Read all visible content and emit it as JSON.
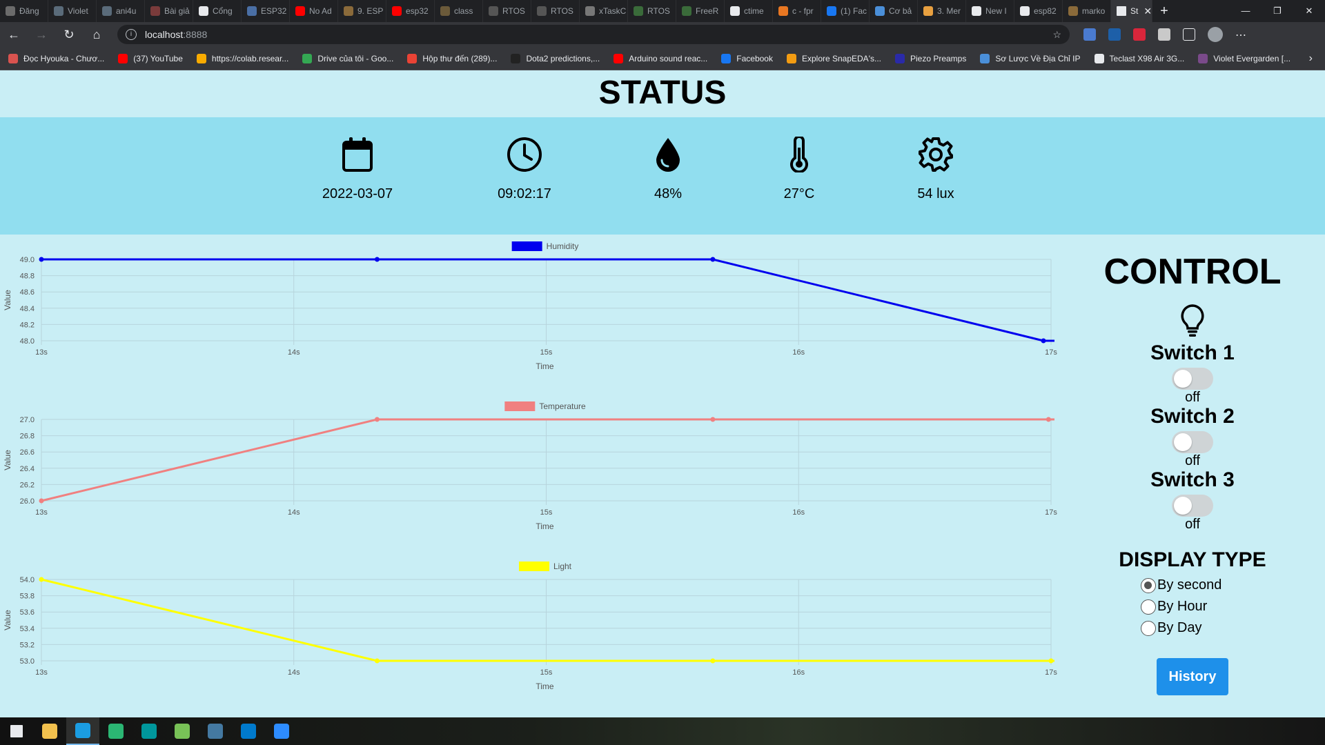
{
  "browser": {
    "tabs": [
      {
        "label": "Đăng",
        "color": "#6b6b6b"
      },
      {
        "label": "Violet",
        "color": "#5a6b7a"
      },
      {
        "label": "ani4u",
        "color": "#5a6b7a"
      },
      {
        "label": "Bài giả",
        "color": "#7a3b3b"
      },
      {
        "label": "Cổng",
        "color": "#e8eaed"
      },
      {
        "label": "ESP32",
        "color": "#4a6fa5"
      },
      {
        "label": "No Ad",
        "color": "#ff0000"
      },
      {
        "label": "9. ESP",
        "color": "#8a6a3a"
      },
      {
        "label": "esp32",
        "color": "#ff0000"
      },
      {
        "label": "class",
        "color": "#6b5a3a"
      },
      {
        "label": "RTOS",
        "color": "#555"
      },
      {
        "label": "RTOS",
        "color": "#555"
      },
      {
        "label": "xTaskC",
        "color": "#777"
      },
      {
        "label": "RTOS",
        "color": "#3a6b3a"
      },
      {
        "label": "FreeR",
        "color": "#3a6b3a"
      },
      {
        "label": "ctime",
        "color": "#e8eaed"
      },
      {
        "label": "c - fpr",
        "color": "#e87722"
      },
      {
        "label": "(1) Fac",
        "color": "#1877f2"
      },
      {
        "label": "Cơ bả",
        "color": "#4a8fd9"
      },
      {
        "label": "3. Mer",
        "color": "#e8a040"
      },
      {
        "label": "New I",
        "color": "#e8eaed"
      },
      {
        "label": "esp82",
        "color": "#e8eaed"
      },
      {
        "label": "marko",
        "color": "#8a6a3a"
      }
    ],
    "active_tab": {
      "label": "St",
      "close": "✕"
    },
    "new_tab": "+",
    "window_controls": {
      "minimize": "—",
      "restore": "❐",
      "close": "✕"
    },
    "url_host": "localhost",
    "url_port": ":8888",
    "bookmarks": [
      {
        "label": "Đọc Hyouka - Chươ...",
        "color": "#d9534f"
      },
      {
        "label": "(37) YouTube",
        "color": "#ff0000"
      },
      {
        "label": "https://colab.resear...",
        "color": "#f9ab00"
      },
      {
        "label": "Drive của tôi - Goo...",
        "color": "#34a853"
      },
      {
        "label": "Hộp thư đến (289)...",
        "color": "#ea4335"
      },
      {
        "label": "Dota2 predictions,...",
        "color": "#222"
      },
      {
        "label": "Arduino sound reac...",
        "color": "#ff0000"
      },
      {
        "label": "Facebook",
        "color": "#1877f2"
      },
      {
        "label": "Explore SnapEDA's...",
        "color": "#f39c12"
      },
      {
        "label": "Piezo Preamps",
        "color": "#2a2aa8"
      },
      {
        "label": "Sơ Lược Về Địa Chỉ IP",
        "color": "#4a8fd9"
      },
      {
        "label": "Teclast X98 Air 3G...",
        "color": "#e8eaed"
      },
      {
        "label": "Violet Evergarden [...",
        "color": "#7a4a8a"
      }
    ]
  },
  "status": {
    "title": "STATUS",
    "date": "2022-03-07",
    "time": "09:02:17",
    "humidity": "48%",
    "temperature": "27°C",
    "light": "54 lux"
  },
  "control": {
    "title": "CONTROL",
    "switches": [
      {
        "label": "Switch 1",
        "state": "off"
      },
      {
        "label": "Switch 2",
        "state": "off"
      },
      {
        "label": "Switch 3",
        "state": "off"
      }
    ],
    "display_type": {
      "title": "DISPLAY TYPE",
      "options": [
        "By second",
        "By Hour",
        "By Day"
      ],
      "selected": "By second"
    },
    "history_button": "History"
  },
  "chart_data": [
    {
      "type": "line",
      "series": [
        {
          "name": "Humidity",
          "color": "#0000ee",
          "x": [
            13,
            14.33,
            15.66,
            16.97
          ],
          "values": [
            49.0,
            49.0,
            49.0,
            48.0
          ]
        }
      ],
      "x_ticks": [
        "13s",
        "14s",
        "15s",
        "16s",
        "17s"
      ],
      "xlim": [
        13,
        17
      ],
      "y_ticks": [
        "49.0",
        "48.8",
        "48.6",
        "48.4",
        "48.2",
        "48.0"
      ],
      "ylim": [
        48.0,
        49.0
      ],
      "xlabel": "Time",
      "ylabel": "Value",
      "grid": true,
      "legend": "top-center"
    },
    {
      "type": "line",
      "series": [
        {
          "name": "Temperature",
          "color": "#f08080",
          "x": [
            13,
            14.33,
            15.66,
            16.99
          ],
          "values": [
            26.0,
            27.0,
            27.0,
            27.0
          ]
        }
      ],
      "x_ticks": [
        "13s",
        "14s",
        "15s",
        "16s",
        "17s"
      ],
      "xlim": [
        13,
        17
      ],
      "y_ticks": [
        "27.0",
        "26.8",
        "26.6",
        "26.4",
        "26.2",
        "26.0"
      ],
      "ylim": [
        26.0,
        27.0
      ],
      "xlabel": "Time",
      "ylabel": "Value",
      "grid": true,
      "legend": "top-center"
    },
    {
      "type": "line",
      "series": [
        {
          "name": "Light",
          "color": "#ffff00",
          "x": [
            13,
            14.33,
            15.66,
            17.0
          ],
          "values": [
            54.0,
            53.0,
            53.0,
            53.0
          ]
        }
      ],
      "x_ticks": [
        "13s",
        "14s",
        "15s",
        "16s",
        "17s"
      ],
      "xlim": [
        13,
        17
      ],
      "y_ticks": [
        "54.0",
        "53.8",
        "53.6",
        "53.4",
        "53.2",
        "53.0"
      ],
      "ylim": [
        53.0,
        54.0
      ],
      "xlabel": "Time",
      "ylabel": "Value",
      "grid": true,
      "legend": "top-center"
    }
  ],
  "taskbar": {
    "items": [
      {
        "name": "start-button",
        "color": "#e8eaed"
      },
      {
        "name": "file-explorer",
        "color": "#f2c14e"
      },
      {
        "name": "edge-browser",
        "color": "#1b9de2"
      },
      {
        "name": "app-green",
        "color": "#2bb673"
      },
      {
        "name": "arduino-ide",
        "color": "#00979c"
      },
      {
        "name": "android-studio",
        "color": "#78c257"
      },
      {
        "name": "mysql-workbench",
        "color": "#4479a1"
      },
      {
        "name": "vscode",
        "color": "#007acc"
      },
      {
        "name": "zoom",
        "color": "#2d8cff"
      }
    ]
  }
}
